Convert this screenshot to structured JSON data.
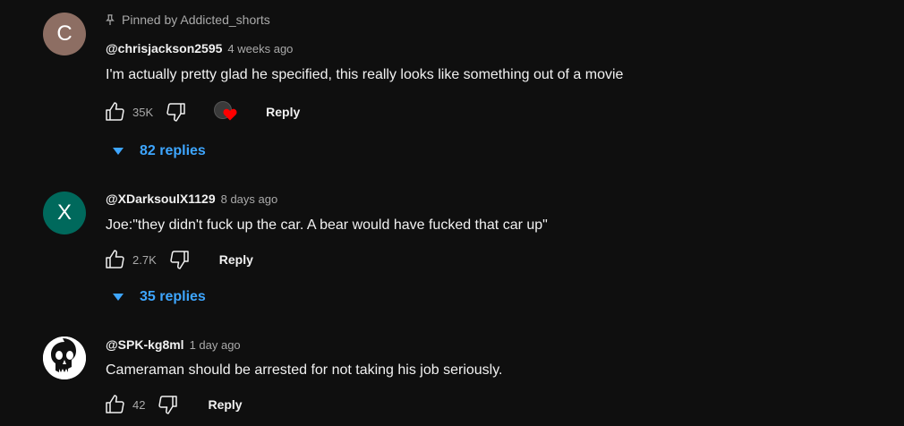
{
  "comments": [
    {
      "avatar_letter": "C",
      "avatar_color": "#8d6e63",
      "pinned_text": "Pinned by Addicted_shorts",
      "author": "@chrisjackson2595",
      "time": "4 weeks ago",
      "text": "I'm actually pretty glad he specified, this really looks like something out of a movie",
      "likes": "35K",
      "creator_heart": true,
      "reply_label": "Reply",
      "replies_label": "82 replies"
    },
    {
      "avatar_letter": "X",
      "avatar_color": "#00695c",
      "author": "@XDarksoulX1129",
      "time": "8 days ago",
      "text": "Joe:\"they didn't fuck up the car. A bear would have fucked that car up\"",
      "likes": "2.7K",
      "reply_label": "Reply",
      "replies_label": "35 replies"
    },
    {
      "avatar_icon": "punisher-skull-icon",
      "author": "@SPK-kg8ml",
      "time": "1 day ago",
      "text": "Cameraman should be arrested for not taking his job seriously.",
      "likes": "42",
      "reply_label": "Reply"
    }
  ],
  "colors": {
    "background": "#0f0f0f",
    "link_blue": "#3ea6ff",
    "heart_red": "#ff0000",
    "secondary_text": "#aaaaaa"
  }
}
